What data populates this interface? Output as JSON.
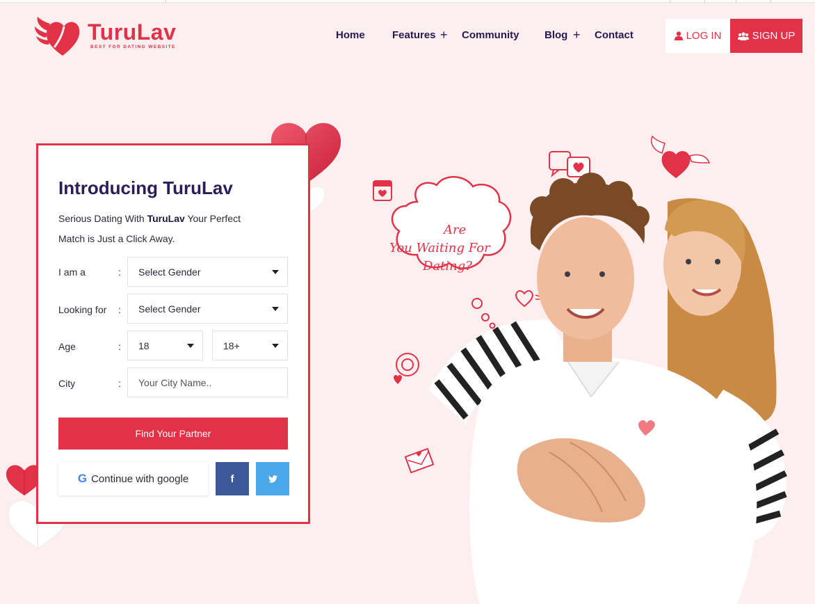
{
  "brand": {
    "name": "TuruLav",
    "tagline": "BEST FOR DATING WEBSITE",
    "color": "#e13248"
  },
  "nav": {
    "items": [
      {
        "label": "Home",
        "has_submenu": false
      },
      {
        "label": "Features",
        "has_submenu": true
      },
      {
        "label": "Community",
        "has_submenu": false
      },
      {
        "label": "Blog",
        "has_submenu": true
      },
      {
        "label": "Contact",
        "has_submenu": false
      }
    ],
    "plus_glyph": "+"
  },
  "auth": {
    "login_label": "LOG IN",
    "login_icon": "user-icon",
    "signup_label": "SIGN UP",
    "signup_icon": "users-icon"
  },
  "form": {
    "title": "Introducing TuruLav",
    "desc_prefix": "Serious Dating With",
    "desc_brand": "TuruLav",
    "desc_suffix": "Your Perfect Match is Just a Click Away.",
    "colon": ":",
    "iam": {
      "label": "I am a",
      "value": "Select Gender"
    },
    "looking": {
      "label": "Looking for",
      "value": "Select Gender"
    },
    "age": {
      "label": "Age",
      "from": "18",
      "to": "18+"
    },
    "city": {
      "label": "City",
      "placeholder": "Your City Name.."
    },
    "submit_label": "Find Your Partner",
    "google_label": "Continue with google",
    "google_letter": "G",
    "facebook_letter": "f",
    "twitter_icon": "twitter-icon"
  },
  "hero": {
    "cloud_line1": "Are",
    "cloud_line2": "You Waiting For",
    "cloud_line3": "Dating?"
  },
  "colors": {
    "accent": "#e13248",
    "background": "#fdeff0",
    "navy": "#2b1d55",
    "facebook": "#3b5998",
    "twitter": "#4aa8e8"
  }
}
